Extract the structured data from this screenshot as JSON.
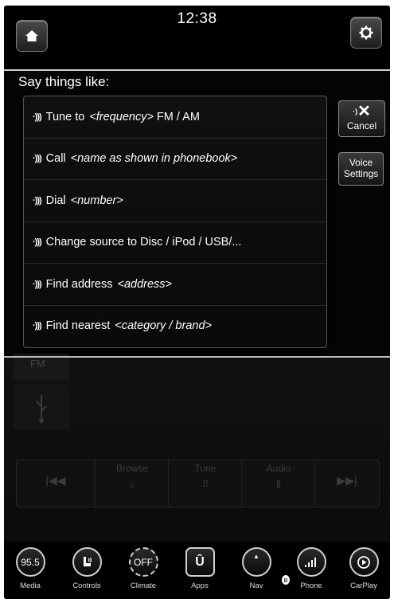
{
  "header": {
    "home_icon": "home-icon",
    "clock": "12:38",
    "settings_icon": "gear-icon"
  },
  "voice_panel": {
    "prompt": "Say things like:",
    "commands": [
      {
        "verb": "Tune to",
        "variable": "<frequency>",
        "after": "FM / AM"
      },
      {
        "verb": "Call",
        "variable": "<name as shown in phonebook>",
        "after": ""
      },
      {
        "verb": "Dial",
        "variable": "<number>",
        "after": ""
      },
      {
        "verb": "Change source to Disc / iPod / USB/...",
        "variable": "",
        "after": ""
      },
      {
        "verb": "Find address",
        "variable": "<address>",
        "after": ""
      },
      {
        "verb": "Find nearest",
        "variable": "<category / brand>",
        "after": ""
      }
    ],
    "cancel_label": "Cancel",
    "voice_settings_line1": "Voice",
    "voice_settings_line2": "Settings"
  },
  "background_player": {
    "source_tab": "FM",
    "controls": [
      "Browse",
      "Tune",
      "Audio"
    ]
  },
  "nav": {
    "items": [
      {
        "label": "Media",
        "icon_text": "95.5",
        "icon": "media-icon"
      },
      {
        "label": "Controls",
        "icon_text": "",
        "icon": "seat-controls-icon"
      },
      {
        "label": "Climate",
        "icon_text": "OFF",
        "icon": "climate-icon"
      },
      {
        "label": "Apps",
        "icon_text": "",
        "icon": "apps-icon"
      },
      {
        "label": "Nav",
        "icon_text": "",
        "icon": "compass-icon"
      },
      {
        "label": "Phone",
        "icon_text": "",
        "icon": "phone-signal-icon"
      },
      {
        "label": "CarPlay",
        "icon_text": "",
        "icon": "carplay-icon"
      }
    ]
  }
}
